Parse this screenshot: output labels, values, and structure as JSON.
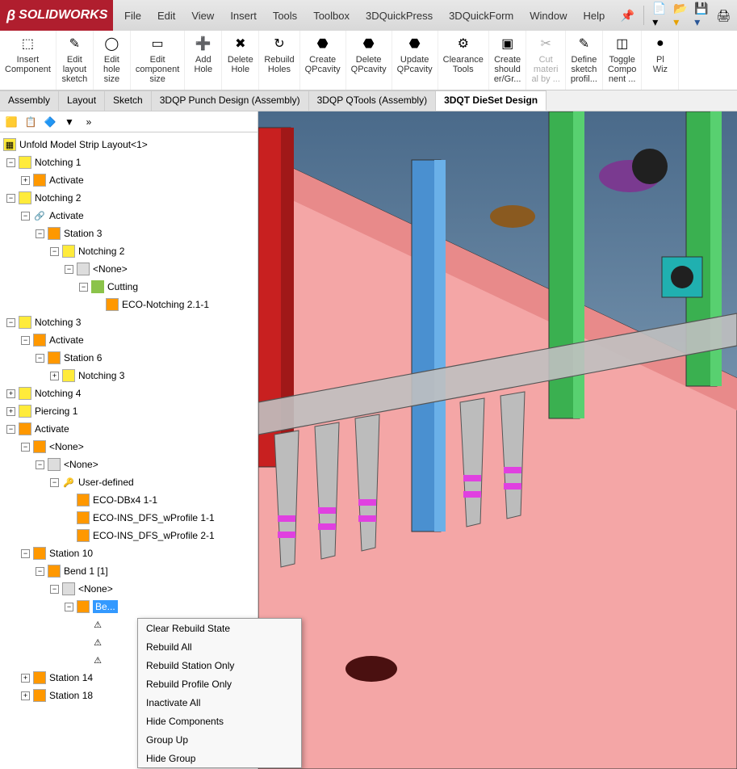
{
  "app": {
    "logo_text": "SOLIDWORKS"
  },
  "menu": [
    "File",
    "Edit",
    "View",
    "Insert",
    "Tools",
    "Toolbox",
    "3DQuickPress",
    "3DQuickForm",
    "Window",
    "Help"
  ],
  "ribbon": [
    {
      "icon": "⬚",
      "label": "Insert\nComponent"
    },
    {
      "icon": "✎",
      "label": "Edit\nlayout\nsketch"
    },
    {
      "icon": "◯",
      "label": "Edit\nhole\nsize"
    },
    {
      "icon": "▭",
      "label": "Edit\ncomponent\nsize"
    },
    {
      "icon": "➕",
      "label": "Add\nHole"
    },
    {
      "icon": "✖",
      "label": "Delete\nHole"
    },
    {
      "icon": "↻",
      "label": "Rebuild\nHoles"
    },
    {
      "icon": "⬣",
      "label": "Create\nQPcavity"
    },
    {
      "icon": "⬣",
      "label": "Delete\nQPcavity"
    },
    {
      "icon": "⬣",
      "label": "Update\nQPcavity"
    },
    {
      "icon": "⚙",
      "label": "Clearance\nTools"
    },
    {
      "icon": "▣",
      "label": "Create\nshould\ner/Gr..."
    },
    {
      "icon": "✂",
      "label": "Cut\nmateri\nal by ...",
      "disabled": true
    },
    {
      "icon": "✎",
      "label": "Define\nsketch\nprofil..."
    },
    {
      "icon": "◫",
      "label": "Toggle\nCompo\nnent ..."
    },
    {
      "icon": "●",
      "label": "Pl\nWiz"
    }
  ],
  "tabs": [
    {
      "label": "Assembly"
    },
    {
      "label": "Layout"
    },
    {
      "label": "Sketch"
    },
    {
      "label": "3DQP Punch Design (Assembly)"
    },
    {
      "label": "3DQP QTools (Assembly)"
    },
    {
      "label": "3DQT DieSet Design",
      "active": true
    }
  ],
  "tree": {
    "root": "Unfold Model Strip Layout<1>",
    "items": [
      {
        "d": 0,
        "t": "-",
        "i": "yellow",
        "l": "Notching 1"
      },
      {
        "d": 1,
        "t": "+",
        "i": "orange",
        "l": "Activate"
      },
      {
        "d": 0,
        "t": "-",
        "i": "yellow",
        "l": "Notching 2"
      },
      {
        "d": 1,
        "t": "-",
        "i": "link",
        "ic": "🔗",
        "l": "Activate"
      },
      {
        "d": 2,
        "t": "-",
        "i": "orange",
        "l": "Station 3"
      },
      {
        "d": 3,
        "t": "-",
        "i": "yellow",
        "l": "Notching 2"
      },
      {
        "d": 4,
        "t": "-",
        "i": "gray",
        "l": "<None>"
      },
      {
        "d": 5,
        "t": "-",
        "i": "green",
        "l": "Cutting"
      },
      {
        "d": 6,
        "t": "",
        "i": "orange",
        "l": "ECO-Notching 2.1-1"
      },
      {
        "d": 0,
        "t": "-",
        "i": "yellow",
        "l": "Notching 3"
      },
      {
        "d": 1,
        "t": "-",
        "i": "orange",
        "l": "Activate"
      },
      {
        "d": 2,
        "t": "-",
        "i": "orange",
        "l": "Station 6"
      },
      {
        "d": 3,
        "t": "+",
        "i": "yellow",
        "l": "Notching 3"
      },
      {
        "d": 0,
        "t": "+",
        "i": "yellow",
        "l": "Notching 4"
      },
      {
        "d": 0,
        "t": "+",
        "i": "yellow",
        "l": "Piercing 1"
      },
      {
        "d": 0,
        "t": "-",
        "i": "orange",
        "l": "Activate"
      },
      {
        "d": 1,
        "t": "-",
        "i": "orange",
        "l": "<None>"
      },
      {
        "d": 2,
        "t": "-",
        "i": "gray",
        "l": "<None>"
      },
      {
        "d": 3,
        "t": "-",
        "i": "",
        "ic": "🔑",
        "l": "User-defined"
      },
      {
        "d": 4,
        "t": "",
        "i": "orange",
        "l": "ECO-DBx4 1-1"
      },
      {
        "d": 4,
        "t": "",
        "i": "orange",
        "l": "ECO-INS_DFS_wProfile 1-1"
      },
      {
        "d": 4,
        "t": "",
        "i": "orange",
        "l": "ECO-INS_DFS_wProfile 2-1"
      },
      {
        "d": 1,
        "t": "-",
        "i": "orange",
        "l": "Station 10"
      },
      {
        "d": 2,
        "t": "-",
        "i": "orange",
        "l": "Bend 1 [1]"
      },
      {
        "d": 3,
        "t": "-",
        "i": "gray",
        "l": "<None>"
      },
      {
        "d": 4,
        "t": "-",
        "i": "orange",
        "l": "Be...",
        "sel": true
      },
      {
        "d": 5,
        "t": "",
        "i": "",
        "ic": "⚠",
        "l": ""
      },
      {
        "d": 5,
        "t": "",
        "i": "",
        "ic": "⚠",
        "l": ""
      },
      {
        "d": 5,
        "t": "",
        "i": "",
        "ic": "⚠",
        "l": ""
      },
      {
        "d": 1,
        "t": "+",
        "i": "orange",
        "l": "Station 14"
      },
      {
        "d": 1,
        "t": "+",
        "i": "orange",
        "l": "Station 18"
      }
    ]
  },
  "context_menu": [
    "Clear Rebuild State",
    "Rebuild All",
    "Rebuild Station Only",
    "Rebuild Profile Only",
    "Inactivate All",
    "Hide Components",
    "Group Up",
    "Hide Group"
  ]
}
